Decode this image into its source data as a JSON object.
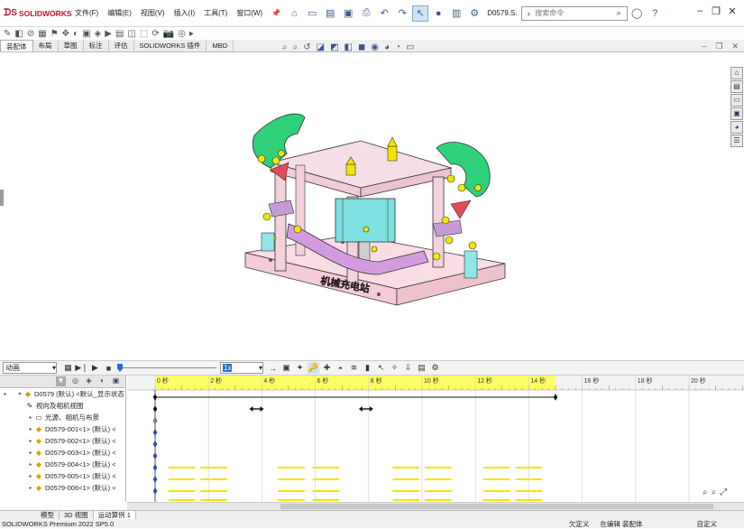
{
  "app": {
    "name": "SOLIDWORKS",
    "document": "D0579.S..."
  },
  "menu": [
    "文件(F)",
    "编辑(E)",
    "视图(V)",
    "插入(I)",
    "工具(T)",
    "窗口(W)"
  ],
  "search": {
    "placeholder": "搜索命令"
  },
  "tabs": [
    "装配体",
    "布局",
    "草图",
    "标注",
    "评估",
    "SOLIDWORKS 插件",
    "MBD"
  ],
  "motion": {
    "study_type": "动画",
    "speed": "1x",
    "playback_position": 0.0
  },
  "tree": {
    "root": "D0579 (默认) <默认_显示状态",
    "items": [
      "视向及相机视图",
      "光源、相机与布景",
      "D0579-001<1> (默认) <",
      "D0579-002<1> (默认) <",
      "D0579-003<1> (默认) <",
      "D0579-004<1> (默认) <",
      "D0579-005<1> (默认) <",
      "D0579-006<1> (默认) <"
    ]
  },
  "timeline": {
    "ticks": [
      "0 秒",
      "2 秒",
      "4 秒",
      "6 秒",
      "8 秒",
      "10 秒",
      "12 秒",
      "14 秒",
      "16 秒",
      "18 秒",
      "20 秒"
    ],
    "highlight_end_seconds": 15,
    "key_end_seconds": 15,
    "markers_seconds": [
      3.8,
      7.9
    ]
  },
  "watermark": "机械充电站",
  "bottom_tabs": [
    "模型",
    "3D 视图",
    "运动算例 1"
  ],
  "status": {
    "left": "SOLIDWORKS Premium 2022 SP5.0",
    "s1": "欠定义",
    "s2": "在编辑 装配体",
    "s3": "自定义"
  },
  "colors": {
    "accent": "#c8102e",
    "timeline_yellow": "#ffff66",
    "part_pink": "#f4d7e0",
    "part_green": "#2fd07a",
    "part_purple": "#c080d0",
    "part_cyan": "#7fe0e0"
  }
}
